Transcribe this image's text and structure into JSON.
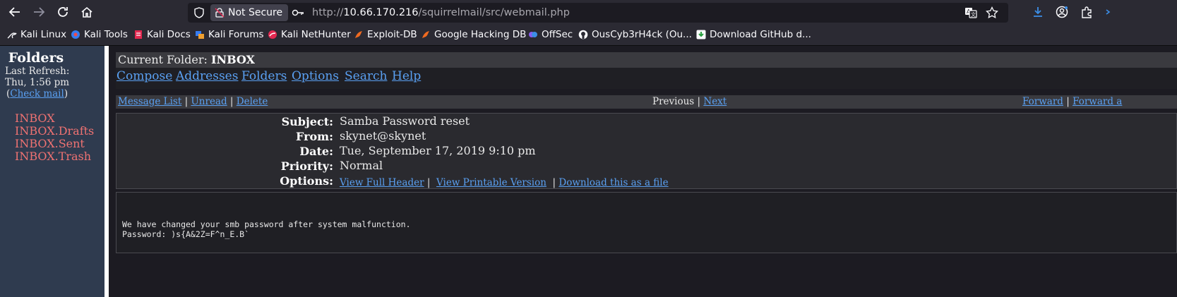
{
  "browser": {
    "url_prefix": "http://",
    "url_host": "10.66.170.216",
    "url_path": "/squirrelmail/src/webmail.php",
    "security_label": "Not Secure",
    "bookmarks": [
      {
        "label": "Kali Linux",
        "icon": "kali-icon"
      },
      {
        "label": "Kali Tools",
        "icon": "kali-tools-icon"
      },
      {
        "label": "Kali Docs",
        "icon": "kali-docs-icon"
      },
      {
        "label": "Kali Forums",
        "icon": "kali-forums-icon"
      },
      {
        "label": "Kali NetHunter",
        "icon": "nethunter-icon"
      },
      {
        "label": "Exploit-DB",
        "icon": "exploitdb-icon"
      },
      {
        "label": "Google Hacking DB",
        "icon": "ghdb-icon"
      },
      {
        "label": "OffSec",
        "icon": "offsec-icon"
      },
      {
        "label": "OusCyb3rH4ck (Ou...",
        "icon": "github-icon"
      },
      {
        "label": "Download GitHub d...",
        "icon": "download-icon"
      }
    ]
  },
  "left": {
    "title": "Folders",
    "last_refresh_label": "Last Refresh:",
    "last_refresh_time": "Thu, 1:56 pm",
    "check_mail": "Check mail",
    "folders": [
      "INBOX",
      "INBOX.Drafts",
      "INBOX.Sent",
      "INBOX.Trash"
    ]
  },
  "main": {
    "current_folder_label": "Current Folder: ",
    "current_folder": "INBOX",
    "menu": [
      "Compose",
      "Addresses",
      "Folders",
      "Options",
      "Search",
      "Help"
    ],
    "nav": {
      "message_list": "Message List",
      "unread": "Unread",
      "delete": "Delete",
      "previous": "Previous",
      "next": "Next",
      "forward": "Forward",
      "forward_as": "Forward a"
    },
    "headers": {
      "subject_label": "Subject:",
      "subject": "Samba Password reset",
      "from_label": "From:",
      "from": "skynet@skynet",
      "date_label": "Date:",
      "date": "Tue, September 17, 2019 9:10 pm",
      "priority_label": "Priority:",
      "priority": "Normal",
      "options_label": "Options:",
      "opt_full_header": "View Full Header",
      "opt_printable": "View Printable Version",
      "opt_download": "Download this as a file"
    },
    "body_line1": "We have changed your smb password after system malfunction.",
    "body_line2": "Password: )s{A&2Z=F^n_E.B`"
  }
}
